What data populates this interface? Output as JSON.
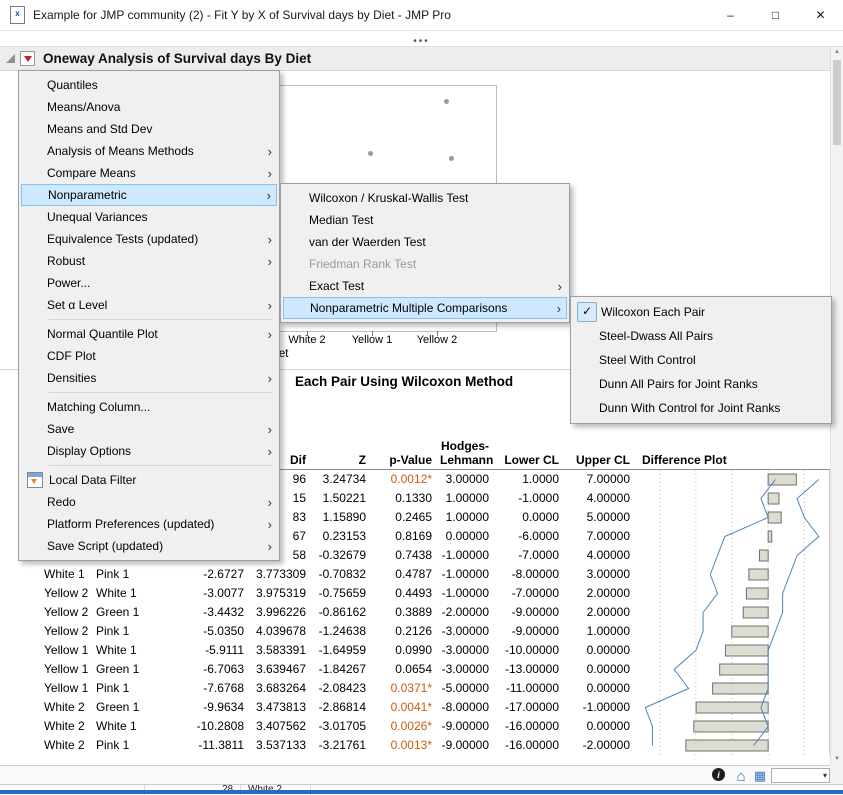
{
  "window": {
    "title": "Example for JMP community (2) - Fit Y by X of Survival days by Diet - JMP Pro",
    "minimize": "–",
    "maximize": "□",
    "close": "✕"
  },
  "toolbar": {
    "handle": "•••"
  },
  "report": {
    "title": "Oneway Analysis of Survival days By Diet",
    "section_title": "Each Pair Using Wilcoxon Method"
  },
  "scatter": {
    "x_ticks": [
      "White 2",
      "Yellow 1",
      "Yellow 2"
    ],
    "axis_label": "Diet",
    "points": [
      [
        444,
        99
      ],
      [
        449,
        156
      ],
      [
        368,
        151
      ]
    ]
  },
  "menus": {
    "main": {
      "items": [
        {
          "label": "Quantiles"
        },
        {
          "label": "Means/Anova"
        },
        {
          "label": "Means and Std Dev"
        },
        {
          "label": "Analysis of Means Methods",
          "submenu": true
        },
        {
          "label": "Compare Means",
          "submenu": true
        },
        {
          "label": "Nonparametric",
          "submenu": true,
          "highlighted": true
        },
        {
          "label": "Unequal Variances"
        },
        {
          "label": "Equivalence Tests (updated)",
          "submenu": true
        },
        {
          "label": "Robust",
          "submenu": true
        },
        {
          "label": "Power..."
        },
        {
          "label": "Set α Level",
          "submenu": true,
          "separator_after": true
        },
        {
          "label": "Normal Quantile Plot",
          "submenu": true
        },
        {
          "label": "CDF Plot"
        },
        {
          "label": "Densities",
          "submenu": true,
          "separator_after": true
        },
        {
          "label": "Matching Column..."
        },
        {
          "label": "Save",
          "submenu": true
        },
        {
          "label": "Display Options",
          "submenu": true,
          "separator_after": true
        },
        {
          "label": "Local Data Filter",
          "icon": true
        },
        {
          "label": "Redo",
          "submenu": true
        },
        {
          "label": "Platform Preferences (updated)",
          "submenu": true
        },
        {
          "label": "Save Script (updated)",
          "submenu": true
        }
      ]
    },
    "nonparametric": {
      "items": [
        {
          "label": "Wilcoxon / Kruskal-Wallis Test"
        },
        {
          "label": "Median Test"
        },
        {
          "label": "van der Waerden Test"
        },
        {
          "label": "Friedman Rank Test",
          "disabled": true
        },
        {
          "label": "Exact Test",
          "submenu": true
        },
        {
          "label": "Nonparametric Multiple Comparisons",
          "submenu": true,
          "highlighted": true
        }
      ]
    },
    "multiple_comparisons": {
      "items": [
        {
          "label": "Wilcoxon Each Pair",
          "checked": true
        },
        {
          "label": "Steel-Dwass All Pairs"
        },
        {
          "label": "Steel With Control"
        },
        {
          "label": "Dunn All Pairs for Joint Ranks"
        },
        {
          "label": "Dunn With Control for Joint Ranks"
        }
      ]
    }
  },
  "table": {
    "headers": {
      "stderr": "Dif",
      "z": "Z",
      "p": "p-Value",
      "hl_line1": "Hodges-",
      "hl_line2": "Lehmann",
      "lower": "Lower CL",
      "upper": "Upper CL",
      "plot": "Difference Plot"
    },
    "rows": [
      {
        "level": "",
        "vs": "",
        "score": "",
        "stderr": "96",
        "z": "3.24734",
        "p": "0.0012*",
        "sig": true,
        "hl": "3.00000",
        "lower": "1.0000",
        "upper": "7.00000",
        "bar": 3.9,
        "lo": 1,
        "hi": 7
      },
      {
        "level": "",
        "vs": "",
        "score": "",
        "stderr": "15",
        "z": "1.50221",
        "p": "0.1330",
        "sig": false,
        "hl": "1.00000",
        "lower": "-1.0000",
        "upper": "4.00000",
        "bar": 1.5,
        "lo": -1,
        "hi": 4
      },
      {
        "level": "",
        "vs": "",
        "score": "",
        "stderr": "83",
        "z": "1.15890",
        "p": "0.2465",
        "sig": false,
        "hl": "1.00000",
        "lower": "0.0000",
        "upper": "5.00000",
        "bar": 1.8,
        "lo": 0,
        "hi": 5
      },
      {
        "level": "",
        "vs": "",
        "score": "",
        "stderr": "67",
        "z": "0.23153",
        "p": "0.8169",
        "sig": false,
        "hl": "0.00000",
        "lower": "-6.0000",
        "upper": "7.00000",
        "bar": 0.5,
        "lo": -6,
        "hi": 7
      },
      {
        "level": "",
        "vs": "",
        "score": "",
        "stderr": "58",
        "z": "-0.32679",
        "p": "0.7438",
        "sig": false,
        "hl": "-1.00000",
        "lower": "-7.0000",
        "upper": "4.00000",
        "bar": -1.2,
        "lo": -7,
        "hi": 4
      },
      {
        "level": "White 1",
        "vs": "Pink 1",
        "score": "-2.6727",
        "stderr": "3.773309",
        "z": "-0.70832",
        "p": "0.4787",
        "sig": false,
        "hl": "-1.00000",
        "lower": "-8.00000",
        "upper": "3.00000",
        "bar": -2.67,
        "lo": -8,
        "hi": 3
      },
      {
        "level": "Yellow 2",
        "vs": "White 1",
        "score": "-3.0077",
        "stderr": "3.975319",
        "z": "-0.75659",
        "p": "0.4493",
        "sig": false,
        "hl": "-1.00000",
        "lower": "-7.00000",
        "upper": "2.00000",
        "bar": -3.01,
        "lo": -7,
        "hi": 2
      },
      {
        "level": "Yellow 2",
        "vs": "Green 1",
        "score": "-3.4432",
        "stderr": "3.996226",
        "z": "-0.86162",
        "p": "0.3889",
        "sig": false,
        "hl": "-2.00000",
        "lower": "-9.00000",
        "upper": "2.00000",
        "bar": -3.44,
        "lo": -9,
        "hi": 2
      },
      {
        "level": "Yellow 2",
        "vs": "Pink 1",
        "score": "-5.0350",
        "stderr": "4.039678",
        "z": "-1.24638",
        "p": "0.2126",
        "sig": false,
        "hl": "-3.00000",
        "lower": "-9.00000",
        "upper": "1.00000",
        "bar": -5.03,
        "lo": -9,
        "hi": 1
      },
      {
        "level": "Yellow 1",
        "vs": "White 1",
        "score": "-5.9111",
        "stderr": "3.583391",
        "z": "-1.64959",
        "p": "0.0990",
        "sig": false,
        "hl": "-3.00000",
        "lower": "-10.00000",
        "upper": "0.00000",
        "bar": -5.91,
        "lo": -10,
        "hi": 0
      },
      {
        "level": "Yellow 1",
        "vs": "Green 1",
        "score": "-6.7063",
        "stderr": "3.639467",
        "z": "-1.84267",
        "p": "0.0654",
        "sig": false,
        "hl": "-3.00000",
        "lower": "-13.00000",
        "upper": "0.00000",
        "bar": -6.71,
        "lo": -13,
        "hi": 0
      },
      {
        "level": "Yellow 1",
        "vs": "Pink 1",
        "score": "-7.6768",
        "stderr": "3.683264",
        "z": "-2.08423",
        "p": "0.0371*",
        "sig": true,
        "hl": "-5.00000",
        "lower": "-11.00000",
        "upper": "0.00000",
        "bar": -7.68,
        "lo": -11,
        "hi": 0
      },
      {
        "level": "White 2",
        "vs": "Green 1",
        "score": "-9.9634",
        "stderr": "3.473813",
        "z": "-2.86814",
        "p": "0.0041*",
        "sig": true,
        "hl": "-8.00000",
        "lower": "-17.00000",
        "upper": "-1.00000",
        "bar": -9.96,
        "lo": -17,
        "hi": -1
      },
      {
        "level": "White 2",
        "vs": "White 1",
        "score": "-10.2808",
        "stderr": "3.407562",
        "z": "-3.01705",
        "p": "0.0026*",
        "sig": true,
        "hl": "-9.00000",
        "lower": "-16.00000",
        "upper": "0.00000",
        "bar": -10.28,
        "lo": -16,
        "hi": 0
      },
      {
        "level": "White 2",
        "vs": "Pink 1",
        "score": "-11.3811",
        "stderr": "3.537133",
        "z": "-3.21761",
        "p": "0.0013*",
        "sig": true,
        "hl": "-9.00000",
        "lower": "-16.00000",
        "upper": "-2.00000",
        "bar": -11.38,
        "lo": -16,
        "hi": -2
      }
    ]
  },
  "diffplot": {
    "x_min": -18,
    "x_max": 8,
    "gridlines": [
      -15,
      -10,
      -5,
      0,
      5
    ]
  },
  "statusbar": {
    "icons": [
      {
        "name": "info-icon",
        "glyph": "i"
      },
      {
        "name": "home-icon",
        "glyph": "⌂"
      },
      {
        "name": "grid-icon",
        "glyph": "▦"
      }
    ],
    "dropdown_caret": "▾"
  },
  "bottom_strip": {
    "row_number": "28",
    "cell_value": "White 2"
  },
  "colors": {
    "menu_highlight": "#cde8ff",
    "menu_highlight_border": "#84c3ef",
    "sig_orange": "#cc5c10",
    "red_triangle": "#cb1f2e",
    "ci_blue": "#4f81bd",
    "bar_fill": "#dcdcd2",
    "bottom_blue": "#2d68c0"
  }
}
